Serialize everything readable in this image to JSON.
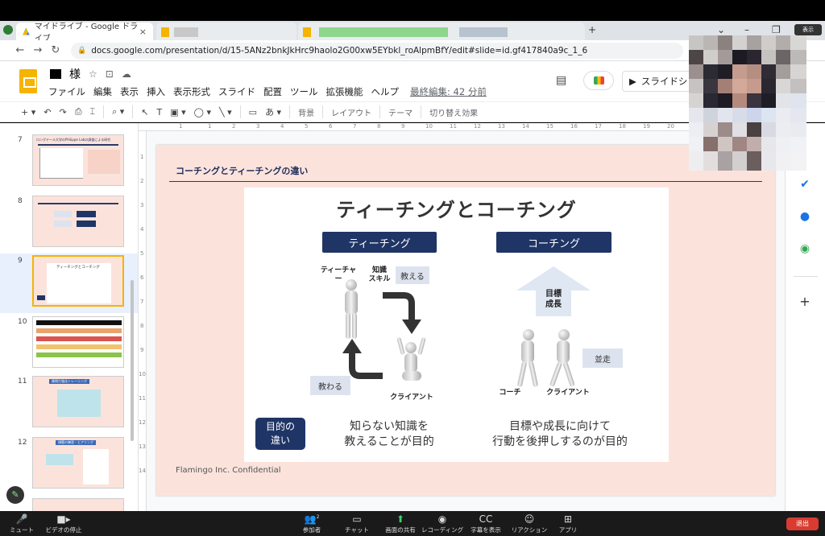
{
  "browser": {
    "tab_title": "マイドライブ - Google ドライブ",
    "new_tab_glyph": "+",
    "url": "docs.google.com/presentation/d/15-5ANz2bnkJkHrc9haolo2G00xw5EYbkl_roAlpmBfY/edit#slide=id.gf417840a9c_1_6",
    "top_right_badge": "表示"
  },
  "app": {
    "doc_title_suffix": "様",
    "menu": [
      "ファイル",
      "編集",
      "表示",
      "挿入",
      "表示形式",
      "スライド",
      "配置",
      "ツール",
      "拡張機能",
      "ヘルプ"
    ],
    "last_edit": "最終編集: 42 分前",
    "slideshow_label": "スライドシ"
  },
  "toolbar": {
    "background_label": "背景",
    "layout_label": "レイアウト",
    "theme_label": "テーマ",
    "transition_label": "切り替え効果"
  },
  "filmstrip": {
    "slides": [
      {
        "num": "7",
        "title": "ロングテール大学のPhilippe Labの調査による研究"
      },
      {
        "num": "8"
      },
      {
        "num": "9",
        "title": "ティーチングとコーチング",
        "selected": true
      },
      {
        "num": "10"
      },
      {
        "num": "11",
        "title": "質問力強化トレーニング"
      },
      {
        "num": "12",
        "title": "傾聴の練習・ヒアリング"
      }
    ]
  },
  "slide": {
    "heading": "コーチングとティーチングの違い",
    "footer": "Flamingo Inc. Confidential",
    "image": {
      "title": "ティーチングとコーチング",
      "teaching_label": "ティーチング",
      "coaching_label": "コーチング",
      "teacher_label": "ティーチャー",
      "knowledge_label": "知識\nスキル",
      "teach_label": "教える",
      "learn_label": "教わる",
      "client_label_left": "クライアント",
      "goal_label": "目標\n成長",
      "run_together_label": "並走",
      "coach_label": "コーチ",
      "client_label_right": "クライアント",
      "purpose_label": "目的の\n違い",
      "teaching_purpose": "知らない知識を\n教えることが目的",
      "coaching_purpose": "目標や成長に向けて\n行動を後押しするのが目的"
    }
  },
  "ruler": {
    "top_ticks": [
      "1",
      "1",
      "2",
      "3",
      "4",
      "5",
      "6",
      "7",
      "8",
      "9",
      "10",
      "11",
      "12",
      "13",
      "14",
      "15",
      "16",
      "17",
      "18",
      "19",
      "20",
      "21",
      "22",
      "23",
      "24",
      "25"
    ],
    "left_ticks": [
      "1",
      "2",
      "3",
      "4",
      "5",
      "6",
      "7",
      "8",
      "9",
      "10",
      "11",
      "12",
      "13",
      "14"
    ]
  },
  "zoom": {
    "items": [
      "ミュート",
      "ビデオの停止",
      "参加者",
      "チャット",
      "画面の共有",
      "レコーディング",
      "字幕を表示",
      "リアクション",
      "アプリ"
    ],
    "participant_count": "2",
    "leave_label": "退出"
  },
  "colors": {
    "slide_bg": "#fbe3dc",
    "navy": "#1f3566",
    "selection": "#f4b400"
  }
}
